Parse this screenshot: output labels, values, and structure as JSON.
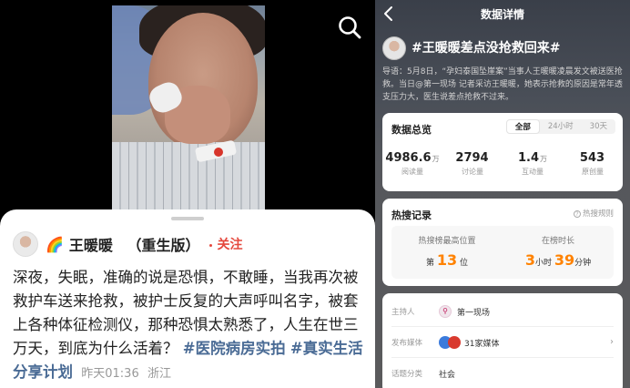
{
  "left": {
    "author": {
      "name": "王暖暖",
      "edition": "（重生版）",
      "emoji": "🌈"
    },
    "follow_label": "关注",
    "post": {
      "text": "深夜，失眠，准确的说是恐惧，不敢睡，当我再次被救护车送来抢救，被护士反复的大声呼叫名字，被套上各种体征检测仪，那种恐惧太熟悉了，人生在世三万天，到底为什么活着？",
      "tags": [
        "#医院病房实拍",
        "#真实生活分享计划"
      ],
      "time": "昨天01:36",
      "location": "浙江"
    },
    "icons": {
      "search": "search-icon"
    }
  },
  "right": {
    "header_title": "数据详情",
    "topic": "#王暖暖差点没抢救回来#",
    "guide": "导语：5月8日，“孕妇泰国坠崖案”当事人王暖暖凌晨发文被送医抢救。当日@第一现场 记者采访王暖暖，她表示抢救的原因是常年透支压力大，医生说差点抢救不过来。",
    "overview": {
      "title": "数据总览",
      "tabs": [
        "全部",
        "24小时",
        "30天"
      ],
      "active_tab": "全部",
      "stats": [
        {
          "value": "4986.6",
          "unit": "万",
          "label": "阅读量"
        },
        {
          "value": "2794",
          "unit": "",
          "label": "讨论量"
        },
        {
          "value": "1.4",
          "unit": "万",
          "label": "互动量"
        },
        {
          "value": "543",
          "unit": "",
          "label": "原创量"
        }
      ]
    },
    "hot": {
      "title": "热搜记录",
      "rule_label": "热搜规则",
      "peak_label": "热搜榜最高位置",
      "peak_prefix": "第",
      "peak_value": "13",
      "peak_suffix": "位",
      "duration_label": "在榜时长",
      "hours": "3",
      "hours_unit": "小时",
      "minutes": "39",
      "minutes_unit": "分钟"
    },
    "info": {
      "host_key": "主持人",
      "host_value": "第一现场",
      "media_key": "发布媒体",
      "media_value": "31家媒体",
      "category_key": "话题分类",
      "category_value": "社会"
    }
  },
  "colors": {
    "accent_orange": "#ff8200",
    "follow_red": "#e5483d",
    "tag_blue": "#4a6b95"
  }
}
